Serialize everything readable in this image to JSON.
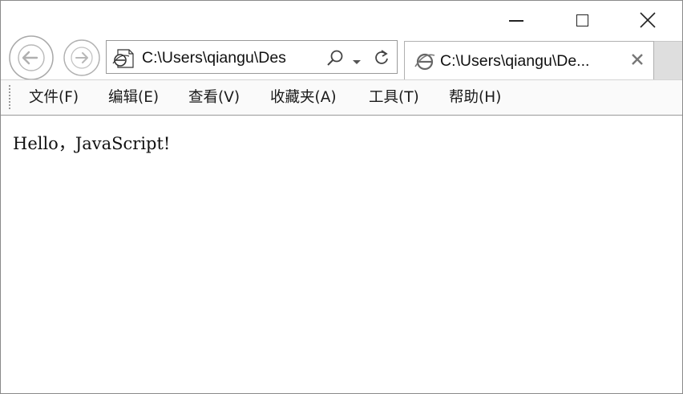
{
  "window": {
    "controls": {
      "minimize_icon": "minimize-icon",
      "maximize_icon": "maximize-icon",
      "close_icon": "close-icon"
    }
  },
  "navigation": {
    "back_icon": "back-arrow-icon",
    "forward_icon": "forward-arrow-icon"
  },
  "address_bar": {
    "url": "C:\\Users\\qiangu\\Des",
    "icons": [
      "ie-page-icon",
      "search-icon",
      "dropdown-icon",
      "refresh-icon"
    ]
  },
  "tab": {
    "title": "C:\\Users\\qiangu\\De...",
    "icon": "ie-logo-icon",
    "close_icon": "close-icon"
  },
  "menubar": {
    "items": [
      {
        "label": "文件(F)"
      },
      {
        "label": "编辑(E)"
      },
      {
        "label": "查看(V)"
      },
      {
        "label": "收藏夹(A)"
      },
      {
        "label": "工具(T)"
      },
      {
        "label": "帮助(H)"
      }
    ]
  },
  "content": {
    "text": "Hello，JavaScript!"
  }
}
